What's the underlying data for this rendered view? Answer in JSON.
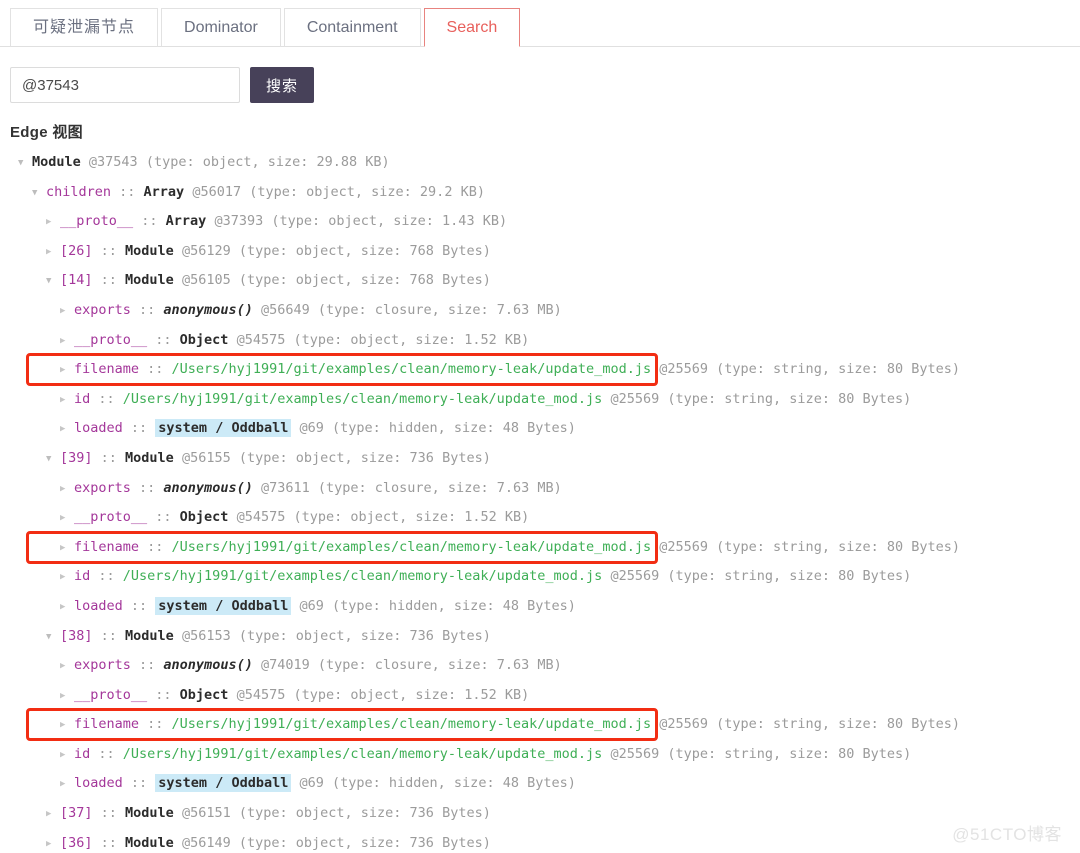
{
  "tabs": [
    {
      "label": "可疑泄漏节点",
      "active": false,
      "cjk": true
    },
    {
      "label": "Dominator",
      "active": false,
      "cjk": false
    },
    {
      "label": "Containment",
      "active": false,
      "cjk": false
    },
    {
      "label": "Search",
      "active": true,
      "cjk": false
    }
  ],
  "search": {
    "value": "@37543",
    "placeholder": "",
    "button_label": "搜索"
  },
  "section": {
    "title": "Edge 视图"
  },
  "colors": {
    "accent_red": "#e8605c",
    "annotation_red": "#f22d13",
    "button_bg": "#474159",
    "key_purple": "#a4379a",
    "string_green": "#3faf56",
    "highlight_blue": "#cceaf7"
  },
  "tree": [
    {
      "indent": 0,
      "toggle": "expanded",
      "key": "",
      "cls": "Module",
      "clsType": "cls",
      "addr": "@37543",
      "meta": "(type: object, size: 29.88 KB)",
      "boxed": false
    },
    {
      "indent": 1,
      "toggle": "expanded",
      "key": "children",
      "cls": "Array",
      "clsType": "cls",
      "addr": "@56017",
      "meta": "(type: object, size: 29.2 KB)",
      "boxed": false
    },
    {
      "indent": 2,
      "toggle": "collapsed",
      "key": "__proto__",
      "cls": "Array",
      "clsType": "cls",
      "addr": "@37393",
      "meta": "(type: object, size: 1.43 KB)",
      "boxed": false
    },
    {
      "indent": 2,
      "toggle": "collapsed",
      "key": "[26]",
      "cls": "Module",
      "clsType": "cls",
      "addr": "@56129",
      "meta": "(type: object, size: 768 Bytes)",
      "boxed": false
    },
    {
      "indent": 2,
      "toggle": "expanded",
      "key": "[14]",
      "cls": "Module",
      "clsType": "cls",
      "addr": "@56105",
      "meta": "(type: object, size: 768 Bytes)",
      "boxed": false
    },
    {
      "indent": 3,
      "toggle": "collapsed",
      "key": "exports",
      "cls": "anonymous()",
      "clsType": "fn",
      "addr": "@56649",
      "meta": "(type: closure, size: 7.63 MB)",
      "boxed": false
    },
    {
      "indent": 3,
      "toggle": "collapsed",
      "key": "__proto__",
      "cls": "Object",
      "clsType": "cls",
      "addr": "@54575",
      "meta": "(type: object, size: 1.52 KB)",
      "boxed": false
    },
    {
      "indent": 3,
      "toggle": "collapsed",
      "key": "filename",
      "cls": "/Users/hyj1991/git/examples/clean/memory-leak/update_mod.js",
      "clsType": "str",
      "addr": "@25569",
      "meta": "(type: string, size: 80 Bytes)",
      "boxed": true
    },
    {
      "indent": 3,
      "toggle": "collapsed",
      "key": "id",
      "cls": "/Users/hyj1991/git/examples/clean/memory-leak/update_mod.js",
      "clsType": "str",
      "addr": "@25569",
      "meta": "(type: string, size: 80 Bytes)",
      "boxed": false
    },
    {
      "indent": 3,
      "toggle": "collapsed",
      "key": "loaded",
      "cls": "system / Oddball",
      "clsType": "hl",
      "addr": "@69",
      "meta": "(type: hidden, size: 48 Bytes)",
      "boxed": false
    },
    {
      "indent": 2,
      "toggle": "expanded",
      "key": "[39]",
      "cls": "Module",
      "clsType": "cls",
      "addr": "@56155",
      "meta": "(type: object, size: 736 Bytes)",
      "boxed": false
    },
    {
      "indent": 3,
      "toggle": "collapsed",
      "key": "exports",
      "cls": "anonymous()",
      "clsType": "fn",
      "addr": "@73611",
      "meta": "(type: closure, size: 7.63 MB)",
      "boxed": false
    },
    {
      "indent": 3,
      "toggle": "collapsed",
      "key": "__proto__",
      "cls": "Object",
      "clsType": "cls",
      "addr": "@54575",
      "meta": "(type: object, size: 1.52 KB)",
      "boxed": false
    },
    {
      "indent": 3,
      "toggle": "collapsed",
      "key": "filename",
      "cls": "/Users/hyj1991/git/examples/clean/memory-leak/update_mod.js",
      "clsType": "str",
      "addr": "@25569",
      "meta": "(type: string, size: 80 Bytes)",
      "boxed": true
    },
    {
      "indent": 3,
      "toggle": "collapsed",
      "key": "id",
      "cls": "/Users/hyj1991/git/examples/clean/memory-leak/update_mod.js",
      "clsType": "str",
      "addr": "@25569",
      "meta": "(type: string, size: 80 Bytes)",
      "boxed": false
    },
    {
      "indent": 3,
      "toggle": "collapsed",
      "key": "loaded",
      "cls": "system / Oddball",
      "clsType": "hl",
      "addr": "@69",
      "meta": "(type: hidden, size: 48 Bytes)",
      "boxed": false
    },
    {
      "indent": 2,
      "toggle": "expanded",
      "key": "[38]",
      "cls": "Module",
      "clsType": "cls",
      "addr": "@56153",
      "meta": "(type: object, size: 736 Bytes)",
      "boxed": false
    },
    {
      "indent": 3,
      "toggle": "collapsed",
      "key": "exports",
      "cls": "anonymous()",
      "clsType": "fn",
      "addr": "@74019",
      "meta": "(type: closure, size: 7.63 MB)",
      "boxed": false
    },
    {
      "indent": 3,
      "toggle": "collapsed",
      "key": "__proto__",
      "cls": "Object",
      "clsType": "cls",
      "addr": "@54575",
      "meta": "(type: object, size: 1.52 KB)",
      "boxed": false
    },
    {
      "indent": 3,
      "toggle": "collapsed",
      "key": "filename",
      "cls": "/Users/hyj1991/git/examples/clean/memory-leak/update_mod.js",
      "clsType": "str",
      "addr": "@25569",
      "meta": "(type: string, size: 80 Bytes)",
      "boxed": true
    },
    {
      "indent": 3,
      "toggle": "collapsed",
      "key": "id",
      "cls": "/Users/hyj1991/git/examples/clean/memory-leak/update_mod.js",
      "clsType": "str",
      "addr": "@25569",
      "meta": "(type: string, size: 80 Bytes)",
      "boxed": false
    },
    {
      "indent": 3,
      "toggle": "collapsed",
      "key": "loaded",
      "cls": "system / Oddball",
      "clsType": "hl",
      "addr": "@69",
      "meta": "(type: hidden, size: 48 Bytes)",
      "boxed": false
    },
    {
      "indent": 2,
      "toggle": "collapsed",
      "key": "[37]",
      "cls": "Module",
      "clsType": "cls",
      "addr": "@56151",
      "meta": "(type: object, size: 736 Bytes)",
      "boxed": false
    },
    {
      "indent": 2,
      "toggle": "collapsed",
      "key": "[36]",
      "cls": "Module",
      "clsType": "cls",
      "addr": "@56149",
      "meta": "(type: object, size: 736 Bytes)",
      "boxed": false
    }
  ],
  "separator": "::",
  "watermark": "@51CTO博客"
}
